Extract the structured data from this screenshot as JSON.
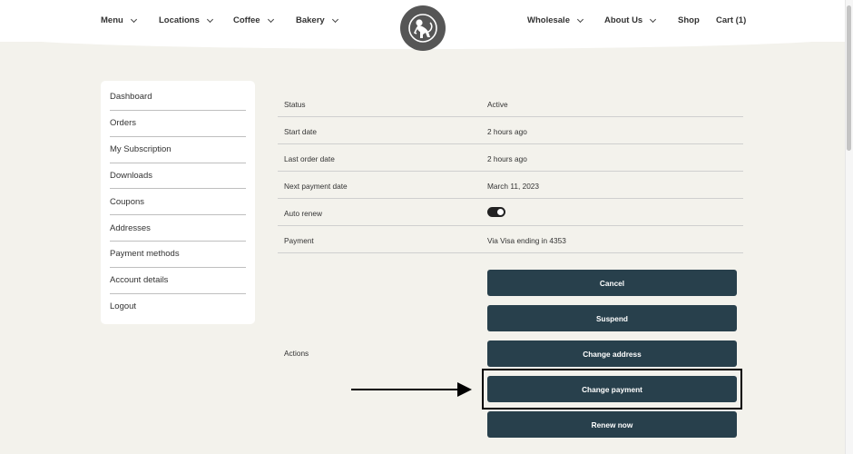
{
  "nav": {
    "left": [
      {
        "label": "Menu"
      },
      {
        "label": "Locations"
      },
      {
        "label": "Coffee"
      },
      {
        "label": "Bakery"
      }
    ],
    "right": [
      {
        "label": "Wholesale"
      },
      {
        "label": "About Us"
      }
    ],
    "shop_label": "Shop",
    "cart_label": "Cart (1)"
  },
  "sidebar": {
    "items": [
      {
        "label": "Dashboard"
      },
      {
        "label": "Orders"
      },
      {
        "label": "My Subscription"
      },
      {
        "label": "Downloads"
      },
      {
        "label": "Coupons"
      },
      {
        "label": "Addresses"
      },
      {
        "label": "Payment methods"
      },
      {
        "label": "Account details"
      },
      {
        "label": "Logout"
      }
    ]
  },
  "details": {
    "status": {
      "label": "Status",
      "value": "Active"
    },
    "start_date": {
      "label": "Start date",
      "value": "2 hours ago"
    },
    "last_order_date": {
      "label": "Last order date",
      "value": "2 hours ago"
    },
    "next_payment_date": {
      "label": "Next payment date",
      "value": "March 11, 2023"
    },
    "auto_renew": {
      "label": "Auto renew",
      "enabled": true
    },
    "payment": {
      "label": "Payment",
      "value": "Via Visa ending in 4353"
    }
  },
  "actions": {
    "label": "Actions",
    "buttons": [
      {
        "label": "Cancel"
      },
      {
        "label": "Suspend"
      },
      {
        "label": "Change address"
      },
      {
        "label": "Change payment"
      },
      {
        "label": "Renew now"
      }
    ]
  },
  "colors": {
    "button_bg": "#28404c",
    "page_bg": "#f3f2ec",
    "logo_bg": "#565656"
  }
}
